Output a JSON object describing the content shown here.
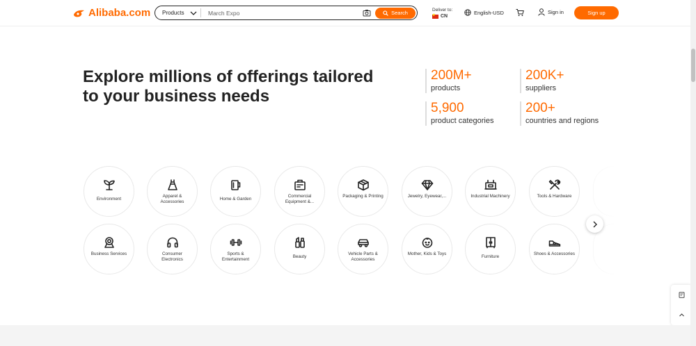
{
  "header": {
    "logo_text": "Alibaba.com",
    "search": {
      "category": "Products",
      "query": "March Expo",
      "button_label": "Search"
    },
    "deliver": {
      "label": "Deliver to:",
      "country": "CN"
    },
    "language": "English-USD",
    "sign_in": "Sign in",
    "sign_up": "Sign up"
  },
  "hero": {
    "title": "Explore millions of offerings tailored to your business needs",
    "stats": [
      {
        "number": "200M+",
        "label": "products"
      },
      {
        "number": "200K+",
        "label": "suppliers"
      },
      {
        "number": "5,900",
        "label": "product categories"
      },
      {
        "number": "200+",
        "label": "countries and regions"
      }
    ]
  },
  "categories": [
    {
      "label": "Environment",
      "icon": "seedling-icon"
    },
    {
      "label": "Apparel & Accessories",
      "icon": "dress-icon"
    },
    {
      "label": "Home & Garden",
      "icon": "mug-icon"
    },
    {
      "label": "Commercial Equipment &...",
      "icon": "cash-register-icon"
    },
    {
      "label": "Packaging & Printing",
      "icon": "box-icon"
    },
    {
      "label": "Jewelry, Eyewear,...",
      "icon": "diamond-icon"
    },
    {
      "label": "Industrial Machinery",
      "icon": "machine-icon"
    },
    {
      "label": "Tools & Hardware",
      "icon": "tools-icon"
    },
    {
      "label": "Business Services",
      "icon": "service-badge-icon"
    },
    {
      "label": "Consumer Electronics",
      "icon": "headphones-icon"
    },
    {
      "label": "Sports & Entertainment",
      "icon": "dumbbell-icon"
    },
    {
      "label": "Beauty",
      "icon": "cosmetics-icon"
    },
    {
      "label": "Vehicle Parts & Accessories",
      "icon": "car-icon"
    },
    {
      "label": "Mother, Kids & Toys",
      "icon": "baby-face-icon"
    },
    {
      "label": "Furniture",
      "icon": "wardrobe-icon"
    },
    {
      "label": "Shoes & Accessories",
      "icon": "shoe-icon"
    }
  ],
  "colors": {
    "accent": "#ff6a00"
  }
}
